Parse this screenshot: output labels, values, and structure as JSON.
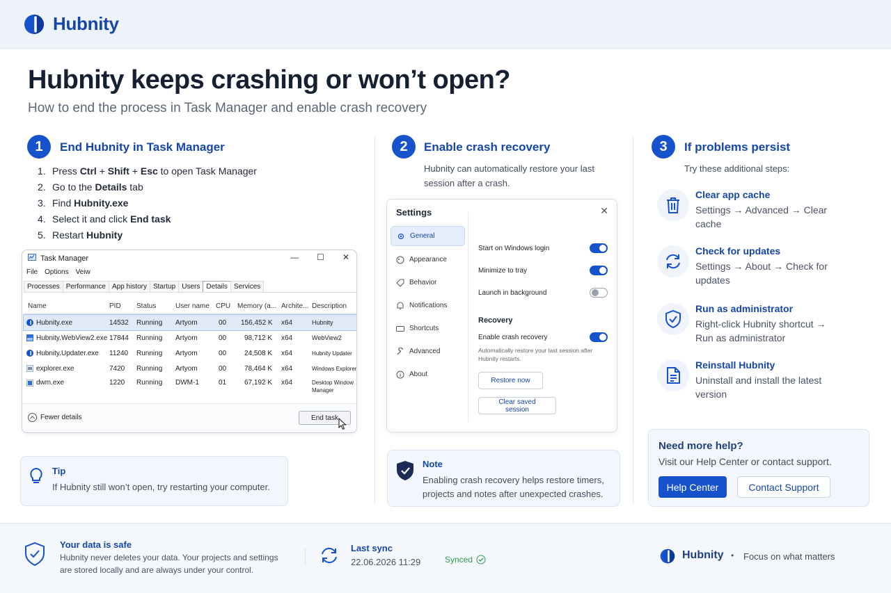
{
  "brand": {
    "name": "Hubnity",
    "accent": "#1652cc"
  },
  "page": {
    "title": "Hubnity keeps crashing or won’t open?",
    "subtitle": "How to end the process in Task Manager and enable crash recovery"
  },
  "step1": {
    "num": "1",
    "title": "End Hubnity in Task Manager",
    "items": [
      {
        "n": "1.",
        "a": "Press ",
        "b1": "Ctrl",
        "c": " + ",
        "b2": "Shift",
        "d": " + ",
        "b3": "Esc",
        "e": " to open Task Manager"
      },
      {
        "n": "2.",
        "a": "Go to the ",
        "b": "Details",
        "c": " tab"
      },
      {
        "n": "3.",
        "a": "Find ",
        "b": "Hubnity.exe"
      },
      {
        "n": "4.",
        "a": "Select it and click ",
        "b": "End task"
      },
      {
        "n": "5.",
        "a": "Restart ",
        "b": "Hubnity"
      }
    ]
  },
  "task_manager": {
    "title": "Task Manager",
    "menu": [
      "File",
      "Options",
      "Veiw"
    ],
    "tabs": [
      "Processes",
      "Performance",
      "App history",
      "Startup",
      "Users",
      "Details",
      "Services"
    ],
    "columns": [
      "Name",
      "PID",
      "Status",
      "User name",
      "CPU",
      "Memory (a...",
      "Archite...",
      "Description"
    ],
    "rows": [
      {
        "name": "Hubnity.exe",
        "pid": "14532",
        "status": "Running",
        "user": "Artyom",
        "cpu": "00",
        "mem": "156,452 K",
        "arch": "x64",
        "desc": "Hubnity"
      },
      {
        "name": "Hubnity.WebView2.exe",
        "pid": "17844",
        "status": "Running",
        "user": "Artyom",
        "cpu": "00",
        "mem": "98,712 K",
        "arch": "x64",
        "desc": "WebView2"
      },
      {
        "name": "Hubnity.Updater.exe",
        "pid": "11240",
        "status": "Running",
        "user": "Artyom",
        "cpu": "00",
        "mem": "24,508 K",
        "arch": "x64",
        "desc": "Hubnity Updater"
      },
      {
        "name": "explorer.exe",
        "pid": "7420",
        "status": "Running",
        "user": "Artyom",
        "cpu": "00",
        "mem": "78,464 K",
        "arch": "x64",
        "desc": "Windows Explorer"
      },
      {
        "name": "dwm.exe",
        "pid": "1220",
        "status": "Running",
        "user": "DWM-1",
        "cpu": "01",
        "mem": "67,192 K",
        "arch": "x64",
        "desc": "Desktop Window Manager"
      }
    ],
    "fewer": "Fewer details",
    "end_task": "End task"
  },
  "tip": {
    "title": "Tip",
    "text": "If Hubnity still won’t open, try restarting your computer."
  },
  "step2": {
    "num": "2",
    "title": "Enable crash recovery",
    "desc": "Hubnity can automatically restore your last session after a crash."
  },
  "settings": {
    "title": "Settings",
    "close": "✕",
    "nav": [
      "General",
      "Appearance",
      "Behavior",
      "Notifications",
      "Shortcuts",
      "Advanced",
      "About"
    ],
    "toggles": [
      {
        "label": "Start on Windows login",
        "on": true
      },
      {
        "label": "Minimize to tray",
        "on": true
      },
      {
        "label": "Launch in background",
        "on": false
      }
    ],
    "recovery_heading": "Recovery",
    "recovery_label": "Enable crash recovery",
    "recovery_note": "Automatically restore your last session after Hubnity restarts.",
    "restore_btn": "Restore now",
    "clear_btn": "Clear saved session"
  },
  "note": {
    "title": "Note",
    "text": "Enabling crash recovery helps restore timers, projects and notes after unexpected crashes."
  },
  "step3": {
    "num": "3",
    "title": "If problems persist",
    "desc": "Try these additional steps:",
    "items": [
      {
        "icon": "trash-icon",
        "title": "Clear app cache",
        "desc": "Settings → Advanced → Clear cache"
      },
      {
        "icon": "refresh-icon",
        "title": "Check for updates",
        "desc": "Settings → About → Check for updates"
      },
      {
        "icon": "shield-check-icon",
        "title": "Run as administrator",
        "desc": "Right-click Hubnity shortcut → Run as administrator"
      },
      {
        "icon": "document-icon",
        "title": "Reinstall Hubnity",
        "desc": "Uninstall and install the latest version"
      }
    ]
  },
  "help": {
    "title": "Need more help?",
    "text": "Visit our Help Center or contact support.",
    "primary": "Help Center",
    "secondary": "Contact Support"
  },
  "footer": {
    "safe_title": "Your data is safe",
    "safe_text": "Hubnity never deletes your data. Your projects and settings are stored locally and are always under your control.",
    "sync_title": "Last sync",
    "sync_time": "22.06.2026 11:29",
    "synced": "Synced",
    "brand": "Hubnity",
    "dot": "•",
    "tagline": "Focus on what matters"
  }
}
